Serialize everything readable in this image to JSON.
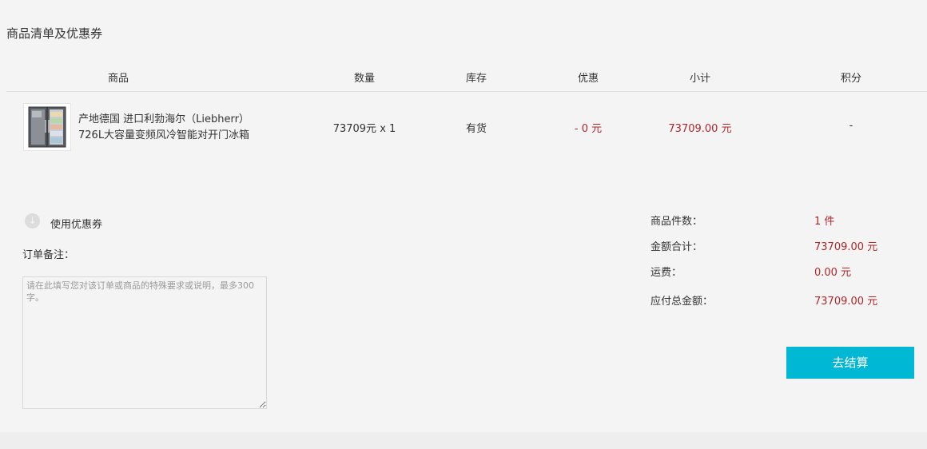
{
  "section_title": "商品清单及优惠券",
  "columns": {
    "product": "商品",
    "quantity": "数量",
    "stock": "库存",
    "discount": "优惠",
    "subtotal": "小计",
    "points": "积分"
  },
  "item": {
    "image_icon": "refrigerator-product-image",
    "name_line1": "产地德国 进口利勃海尔（Liebherr）",
    "name_line2": "726L大容量变频风冷智能对开门冰箱",
    "quantity": "73709元 x 1",
    "stock": "有货",
    "discount": "- 0 元",
    "subtotal": "73709.00 元",
    "points": "-"
  },
  "coupon": {
    "icon": "arrow-down-circle-icon",
    "icon_glyph": "↓",
    "label": "使用优惠券"
  },
  "remark": {
    "label": "订单备注：",
    "placeholder": "请在此填写您对该订单或商品的特殊要求或说明，最多300字。",
    "value": ""
  },
  "summary": {
    "count_label": "商品件数：",
    "count_value": "1 件",
    "total_label": "金额合计：",
    "total_value": "73709.00 元",
    "shipping_label": "运费：",
    "shipping_value": "0.00 元",
    "payable_label": "应付总金额：",
    "payable_value": "73709.00 元"
  },
  "checkout_label": "去结算",
  "colors": {
    "accent": "#00b7d4",
    "price_red": "#b0262a",
    "panel_bg": "#f4f4f4",
    "page_bg": "#eeeeee"
  }
}
